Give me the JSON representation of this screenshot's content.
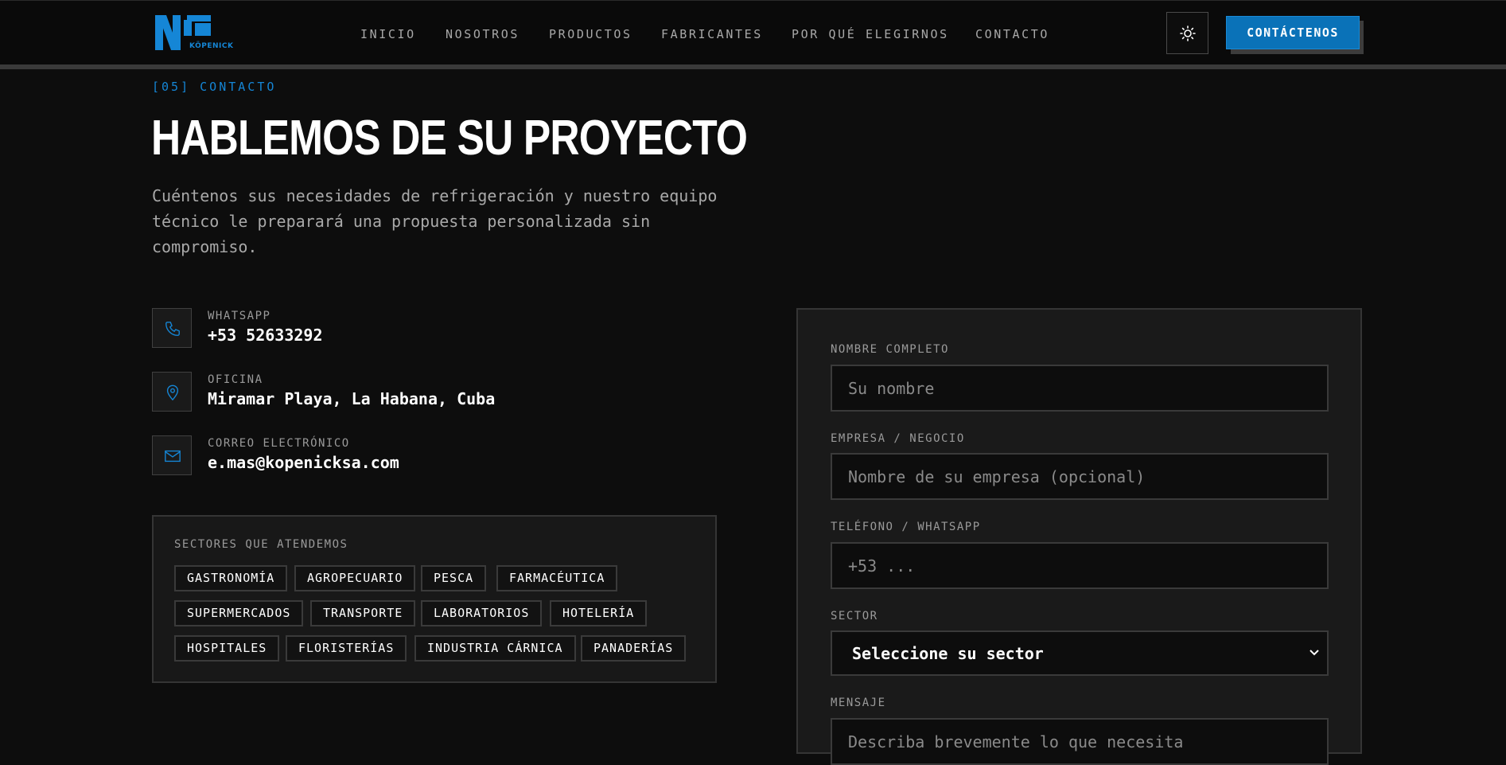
{
  "brand": {
    "logo_text": "KÖPENICK",
    "accent": "#1586d6"
  },
  "nav": {
    "items": [
      "INICIO",
      "NOSOTROS",
      "PRODUCTOS",
      "FABRICANTES",
      "POR QUÉ ELEGIRNOS",
      "CONTACTO"
    ]
  },
  "header": {
    "theme_icon": "sun-icon",
    "cta_label": "CONTÁCTENOS"
  },
  "hero": {
    "eyebrow": "[05] CONTACTO",
    "title": "HABLEMOS DE SU PROYECTO",
    "intro": "Cuéntenos sus necesidades de refrigeración y nuestro equipo técnico le preparará una propuesta personalizada sin compromiso."
  },
  "contacts": [
    {
      "icon": "phone-icon",
      "label": "WHATSAPP",
      "value": "+53 52633292"
    },
    {
      "icon": "location-pin-icon",
      "label": "OFICINA",
      "value": "Miramar Playa, La Habana, Cuba"
    },
    {
      "icon": "mail-icon",
      "label": "CORREO ELECTRÓNICO",
      "value": "e.mas@kopenicksa.com"
    }
  ],
  "sectors": {
    "title": "SECTORES QUE ATENDEMOS",
    "tags": [
      "GASTRONOMÍA",
      "AGROPECUARIO",
      "PESCA",
      "FARMACÉUTICA",
      "SUPERMERCADOS",
      "TRANSPORTE",
      "LABORATORIOS",
      "HOTELERÍA",
      "HOSPITALES",
      "FLORISTERÍAS",
      "INDUSTRIA CÁRNICA",
      "PANADERÍAS"
    ]
  },
  "form": {
    "name_label": "NOMBRE COMPLETO",
    "name_placeholder": "Su nombre",
    "company_label": "EMPRESA / NEGOCIO",
    "company_placeholder": "Nombre de su empresa (opcional)",
    "phone_label": "TELÉFONO / WHATSAPP",
    "phone_placeholder": "+53 ...",
    "sector_label": "SECTOR",
    "sector_value": "Seleccione su sector",
    "message_label": "MENSAJE",
    "message_placeholder": "Describa brevemente lo que necesita"
  }
}
